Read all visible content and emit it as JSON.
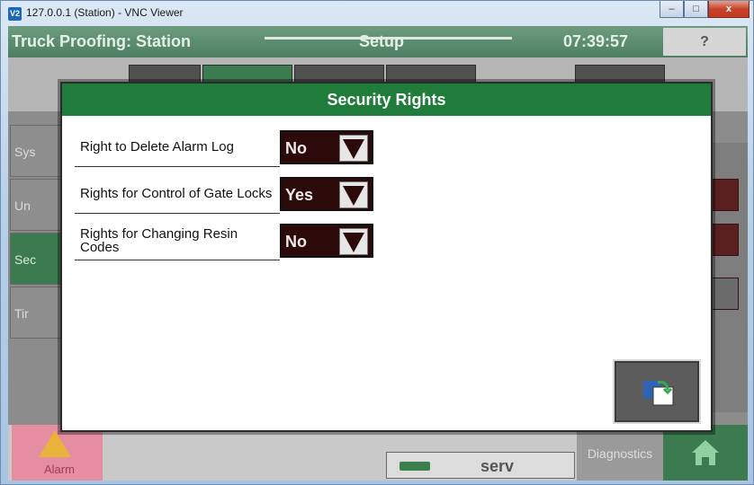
{
  "window": {
    "title": "127.0.0.1 (Station) - VNC Viewer",
    "logo_text": "V2",
    "controls": {
      "minimize": "–",
      "maximize": "□",
      "close": "x"
    }
  },
  "header": {
    "title": "Truck Proofing: Station",
    "section": "Setup",
    "time": "07:39:57",
    "help_label": "?"
  },
  "side_nav": {
    "items": [
      {
        "label": "Sys"
      },
      {
        "label": "Un"
      },
      {
        "label": "Sec"
      },
      {
        "label": "Tir"
      }
    ]
  },
  "bottom": {
    "alarm_label": "Alarm",
    "serv_label": "serv",
    "diagnostics_label": "Diagnostics"
  },
  "modal": {
    "title": "Security Rights",
    "settings": [
      {
        "label": "Right to Delete Alarm Log",
        "value": "No"
      },
      {
        "label": "Rights for Control of Gate Locks",
        "value": "Yes"
      },
      {
        "label": "Rights for Changing Resin Codes",
        "value": "No"
      }
    ]
  },
  "colors": {
    "header_green": "#1f7c3a",
    "select_bg": "#2d0a0a",
    "alarm_pink": "#e58ea1",
    "home_green": "#3c7a4f"
  },
  "icons": {
    "dropdown": "triangle-down-icon",
    "exit": "exit-icon",
    "home": "home-icon",
    "alarm": "warning-icon",
    "key": "key-icon"
  }
}
